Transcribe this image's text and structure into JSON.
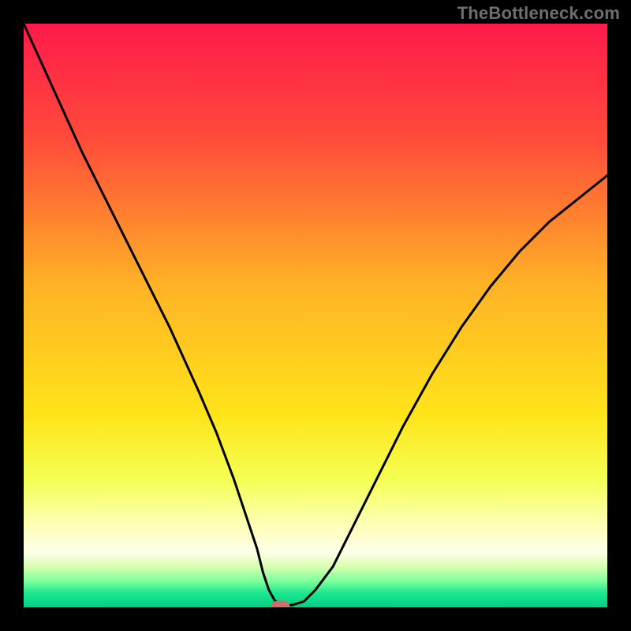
{
  "watermark": "TheBottleneck.com",
  "chart_data": {
    "type": "line",
    "title": "",
    "xlabel": "",
    "ylabel": "",
    "xlim": [
      0,
      100
    ],
    "ylim": [
      0,
      100
    ],
    "grid": false,
    "legend": false,
    "background_gradient_stops": [
      {
        "offset": 0.0,
        "color": "#ff1a4b"
      },
      {
        "offset": 0.2,
        "color": "#ff4c3a"
      },
      {
        "offset": 0.45,
        "color": "#ffb326"
      },
      {
        "offset": 0.67,
        "color": "#ffe41a"
      },
      {
        "offset": 0.78,
        "color": "#f4ff52"
      },
      {
        "offset": 0.86,
        "color": "#fdffb8"
      },
      {
        "offset": 0.905,
        "color": "#ffffe8"
      },
      {
        "offset": 0.93,
        "color": "#d8ffb0"
      },
      {
        "offset": 0.955,
        "color": "#7dff9e"
      },
      {
        "offset": 0.975,
        "color": "#1fe890"
      },
      {
        "offset": 1.0,
        "color": "#00cf86"
      }
    ],
    "series": [
      {
        "name": "curve",
        "color": "#000000",
        "x": [
          0,
          5,
          10,
          15,
          20,
          25,
          30,
          33,
          36,
          38,
          40,
          41,
          42,
          43,
          44,
          45,
          46,
          48,
          50,
          53,
          56,
          60,
          65,
          70,
          75,
          80,
          85,
          90,
          95,
          100
        ],
        "y": [
          100,
          89,
          78,
          68,
          58,
          48,
          37,
          30,
          22,
          16,
          10,
          6,
          3,
          1.2,
          0.5,
          0.3,
          0.4,
          1.0,
          3,
          7,
          13,
          21,
          31,
          40,
          48,
          55,
          61,
          66,
          70,
          74
        ]
      }
    ],
    "marker": {
      "name": "optimum-marker",
      "x": 44,
      "y": 0.3,
      "rx": 1.6,
      "ry": 0.9,
      "color": "#c9726a"
    }
  }
}
